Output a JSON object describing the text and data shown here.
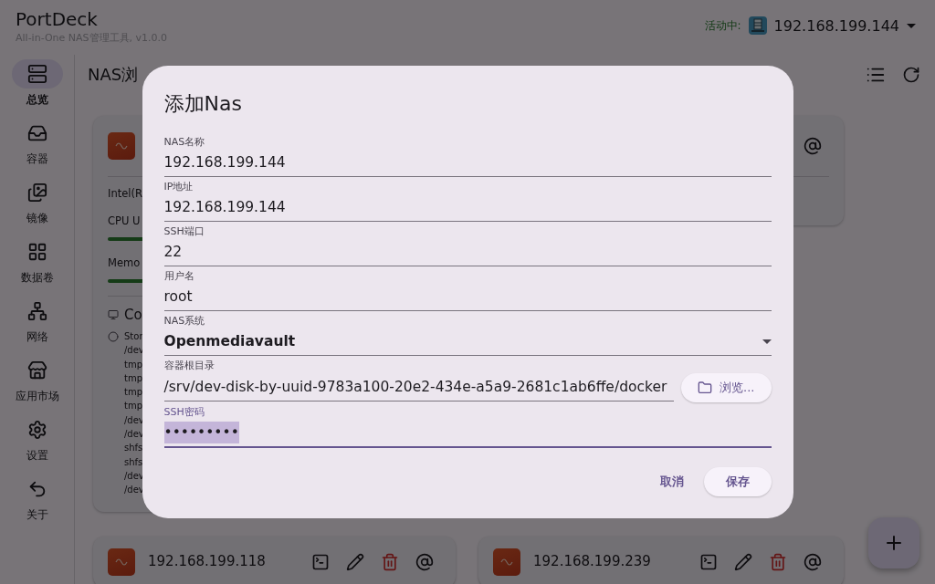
{
  "app": {
    "title": "PortDeck",
    "subtitle": "All-in-One NAS管理工具, v1.0.0"
  },
  "active": {
    "label": "活动中:",
    "host": "192.168.199.144"
  },
  "sidebar": {
    "items": [
      {
        "label": "总览",
        "selected": true
      },
      {
        "label": "容器",
        "selected": false
      },
      {
        "label": "镜像",
        "selected": false
      },
      {
        "label": "数据卷",
        "selected": false
      },
      {
        "label": "网络",
        "selected": false
      },
      {
        "label": "应用市场",
        "selected": false
      },
      {
        "label": "设置",
        "selected": false
      },
      {
        "label": "关于",
        "selected": false
      }
    ]
  },
  "page": {
    "title": "NAS浏"
  },
  "cards": [
    {
      "kind": "detail",
      "cpu_model": "Intel(R",
      "cpu_label": "CPU U",
      "memory_label": "Memo",
      "containers_label": "Co",
      "storage_label": "Stor",
      "mounts": [
        "/dev",
        "tmp",
        "tmp",
        "tmp",
        "tmp",
        "/dev",
        "/dev",
        "shfs",
        "shfs",
        "/dev",
        "/dev"
      ]
    },
    {
      "kind": "covered"
    },
    {
      "kind": "summary",
      "host": "192.168.199.118"
    },
    {
      "kind": "summary",
      "host": "192.168.199.239"
    }
  ],
  "dialog": {
    "title": "添加Nas",
    "fields": [
      {
        "kind": "text",
        "label": "NAS名称",
        "value": "192.168.199.144",
        "focused": false
      },
      {
        "kind": "text",
        "label": "IP地址",
        "value": "192.168.199.144",
        "focused": false
      },
      {
        "kind": "text",
        "label": "SSH端口",
        "value": "22",
        "focused": false
      },
      {
        "kind": "text",
        "label": "用户名",
        "value": "root",
        "focused": false
      },
      {
        "kind": "select",
        "label": "NAS系统",
        "value": "Openmediavault",
        "focused": false
      },
      {
        "kind": "path",
        "label": "容器根目录",
        "value": "/srv/dev-disk-by-uuid-9783a100-20e2-434e-a5a9-2681c1ab6ffe/docker",
        "button": "浏览...",
        "focused": false
      },
      {
        "kind": "password",
        "label": "SSH密码",
        "value": "•••••••••",
        "focused": true
      }
    ],
    "cancel": "取消",
    "save": "保存"
  }
}
